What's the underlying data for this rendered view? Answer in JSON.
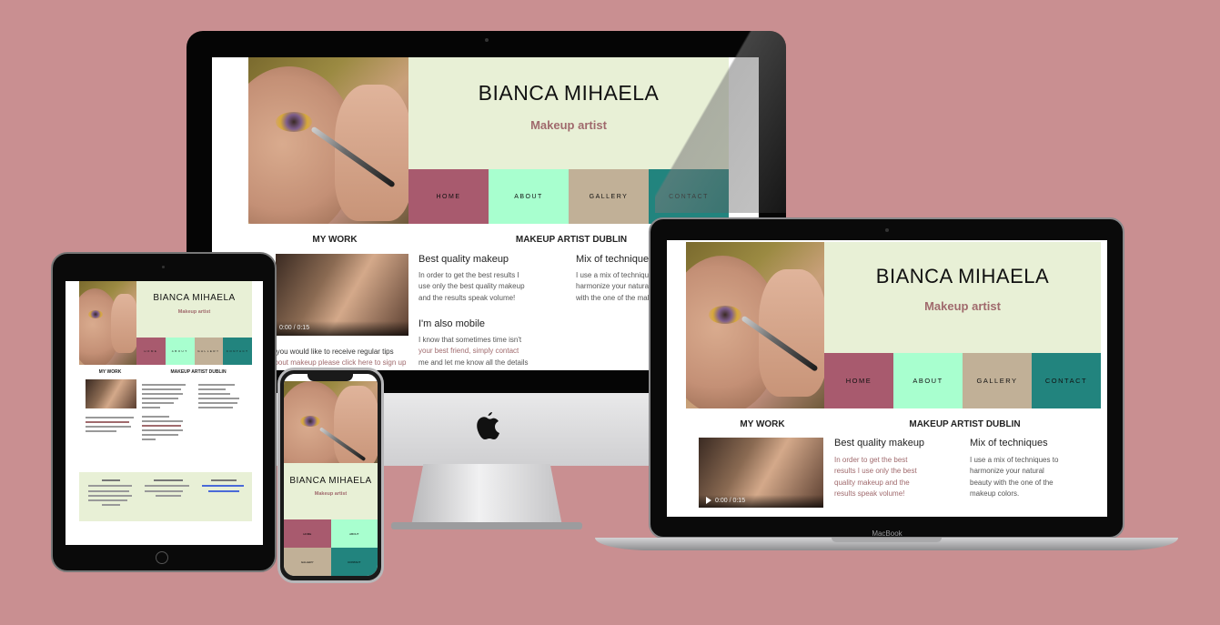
{
  "site": {
    "name": "BIANCA MIHAELA",
    "tagline": "Makeup artist",
    "nav": [
      "HOME",
      "ABOUT",
      "GALLERY",
      "CONTACT"
    ],
    "sections": {
      "work": "MY WORK",
      "dublin": "MAKEUP ARTIST DUBLIN"
    },
    "blocks": {
      "quality_title": "Best quality makeup",
      "quality_text_1": "In order to get the best results I",
      "quality_text_2": "use only the best quality makeup",
      "quality_text_3": "and the results speak volume!",
      "mix_title": "Mix of techniques",
      "mix_text_1": "I use a mix of techniques to",
      "mix_text_2": "harmonize your natural beauty",
      "mix_text_3": "with the one of the makeup colors.",
      "mobile_title": "I'm also mobile",
      "mobile_text_1": "I know that sometimes time isn't",
      "mobile_text_2": "your best friend, simply contact",
      "mobile_text_3": "me and let me know all the details",
      "tips_1": "If you would like to receive regular tips",
      "tips_2": "about makeup please click here to sign up"
    },
    "laptop_blocks": {
      "quality_1": "In order to get the best",
      "quality_2": "results I use only the best",
      "quality_3": "quality makeup and the",
      "quality_4": "results speak volume!",
      "mix_1": "I use a mix of techniques to",
      "mix_2": "harmonize your natural",
      "mix_3": "beauty with the one of the",
      "mix_4": "makeup colors."
    },
    "video_time": "0:00 / 0:15"
  },
  "devices": {
    "laptop_brand": "MacBook"
  },
  "colors": {
    "background": "#c98f91",
    "banner": "#e8f0d6",
    "home": "#a85a6e",
    "about": "#a8ffcf",
    "gallery": "#c1b097",
    "contact": "#22847e",
    "accent": "#a06a6d"
  }
}
